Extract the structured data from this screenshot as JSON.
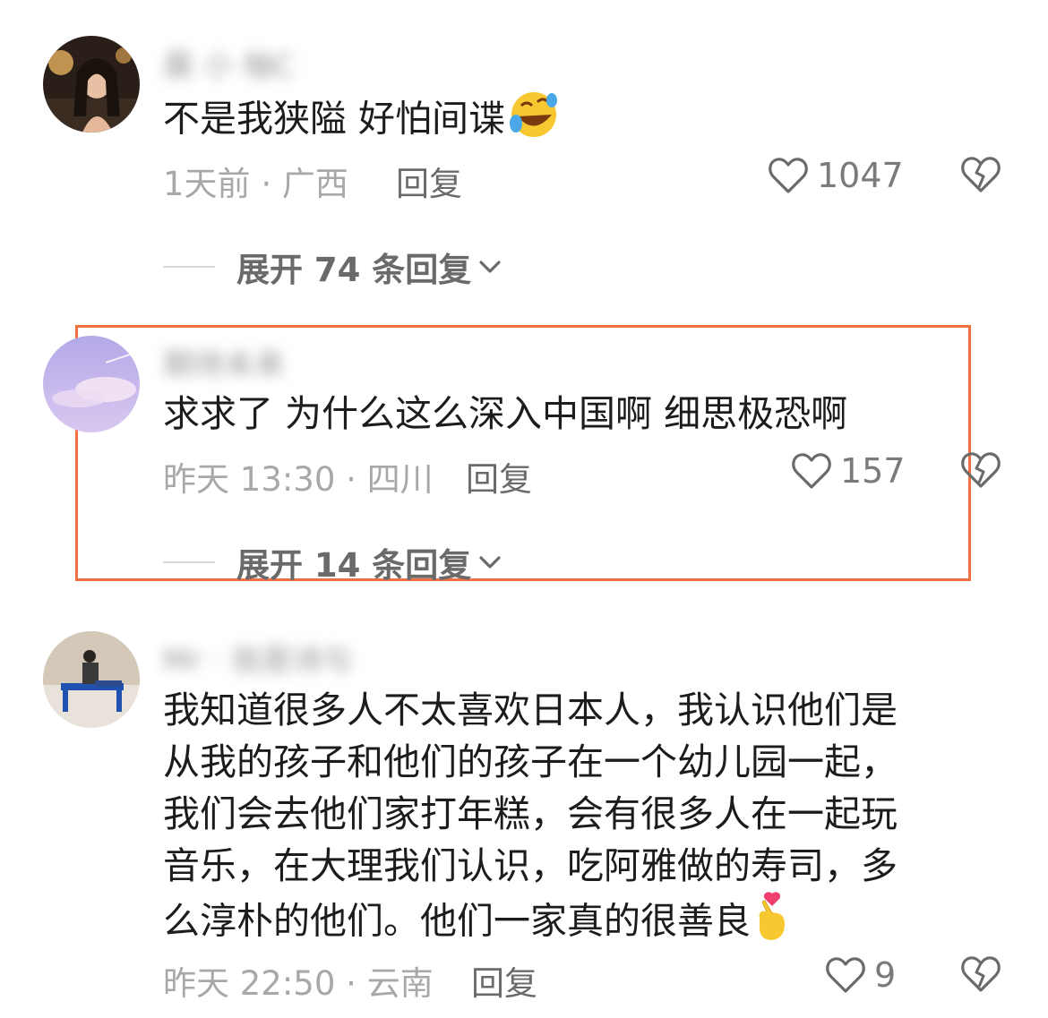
{
  "comments": [
    {
      "username": "晨 小 柚C",
      "text": "不是我狭隘 好怕间谍",
      "emoji": "rolling-laughing-emoji",
      "time": "1天前",
      "separator": "·",
      "location": "广西",
      "reply_label": "回复",
      "likes": "1047",
      "expand_label": "展开 74 条回复"
    },
    {
      "username": "期待未来",
      "text": "求求了 为什么这么深入中国啊 细思极恐啊",
      "time": "昨天 13:30",
      "separator": "·",
      "location": "四川",
      "reply_label": "回复",
      "likes": "157",
      "expand_label": "展开 14 条回复"
    },
    {
      "username": "Mr · 翁是诗与",
      "text_lines": [
        "我知道很多人不太喜欢日本人，我认识他们是",
        "从我的孩子和他们的孩子在一个幼儿园一起，",
        "我们会去他们家打年糕，会有很多人在一起玩",
        "音乐，在大理我们认识，吃阿雅做的寿司，多",
        "么淳朴的他们。他们一家真的很善良"
      ],
      "emoji": "finger-heart-emoji",
      "time": "昨天 22:50",
      "separator": "·",
      "location": "云南",
      "reply_label": "回复",
      "likes": "9"
    }
  ],
  "colors": {
    "highlight": "#f07040",
    "text": "#1c1c1c",
    "meta": "#a8a8a8",
    "reply": "#6a6a6a"
  },
  "icons": [
    "heart-icon",
    "broken-heart-icon",
    "chevron-down-icon"
  ]
}
